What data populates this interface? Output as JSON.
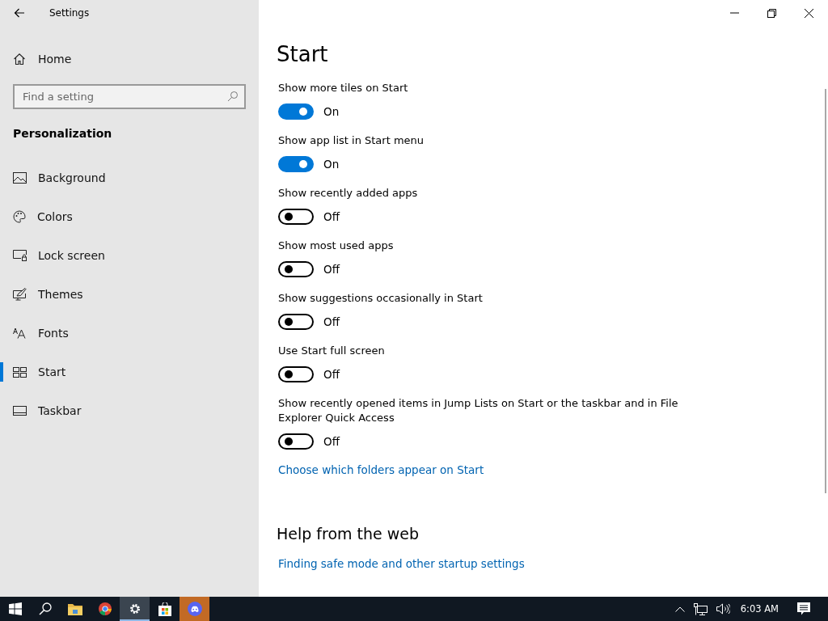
{
  "window": {
    "title": "Settings"
  },
  "sidebar": {
    "home": "Home",
    "search": {
      "placeholder": "Find a setting"
    },
    "section": "Personalization",
    "items": [
      {
        "label": "Background",
        "kind": "background",
        "selected": false
      },
      {
        "label": "Colors",
        "kind": "colors",
        "selected": false
      },
      {
        "label": "Lock screen",
        "kind": "lock",
        "selected": false
      },
      {
        "label": "Themes",
        "kind": "themes",
        "selected": false
      },
      {
        "label": "Fonts",
        "kind": "fonts",
        "selected": false
      },
      {
        "label": "Start",
        "kind": "start",
        "selected": true
      },
      {
        "label": "Taskbar",
        "kind": "taskbar",
        "selected": false
      }
    ]
  },
  "main": {
    "title": "Start",
    "settings": [
      {
        "label": "Show more tiles on Start",
        "on": true,
        "state": "On"
      },
      {
        "label": "Show app list in Start menu",
        "on": true,
        "state": "On"
      },
      {
        "label": "Show recently added apps",
        "on": false,
        "state": "Off"
      },
      {
        "label": "Show most used apps",
        "on": false,
        "state": "Off"
      },
      {
        "label": "Show suggestions occasionally in Start",
        "on": false,
        "state": "Off"
      },
      {
        "label": "Use Start full screen",
        "on": false,
        "state": "Off"
      },
      {
        "label": "Show recently opened items in Jump Lists on Start or the taskbar and in File Explorer Quick Access",
        "on": false,
        "state": "Off"
      }
    ],
    "link": "Choose which folders appear on Start",
    "help": {
      "heading": "Help from the web",
      "links": [
        "Finding safe mode and other startup settings"
      ]
    }
  },
  "taskbar": {
    "apps": [
      {
        "kind": "start",
        "selected": false,
        "attention": false
      },
      {
        "kind": "search",
        "selected": false,
        "attention": false
      },
      {
        "kind": "folder",
        "selected": false,
        "attention": false
      },
      {
        "kind": "browser",
        "selected": false,
        "attention": false
      },
      {
        "kind": "settings",
        "selected": true,
        "attention": false
      },
      {
        "kind": "store",
        "selected": false,
        "attention": false
      },
      {
        "kind": "chat",
        "selected": false,
        "attention": true
      }
    ],
    "clock": "6:03 AM"
  }
}
